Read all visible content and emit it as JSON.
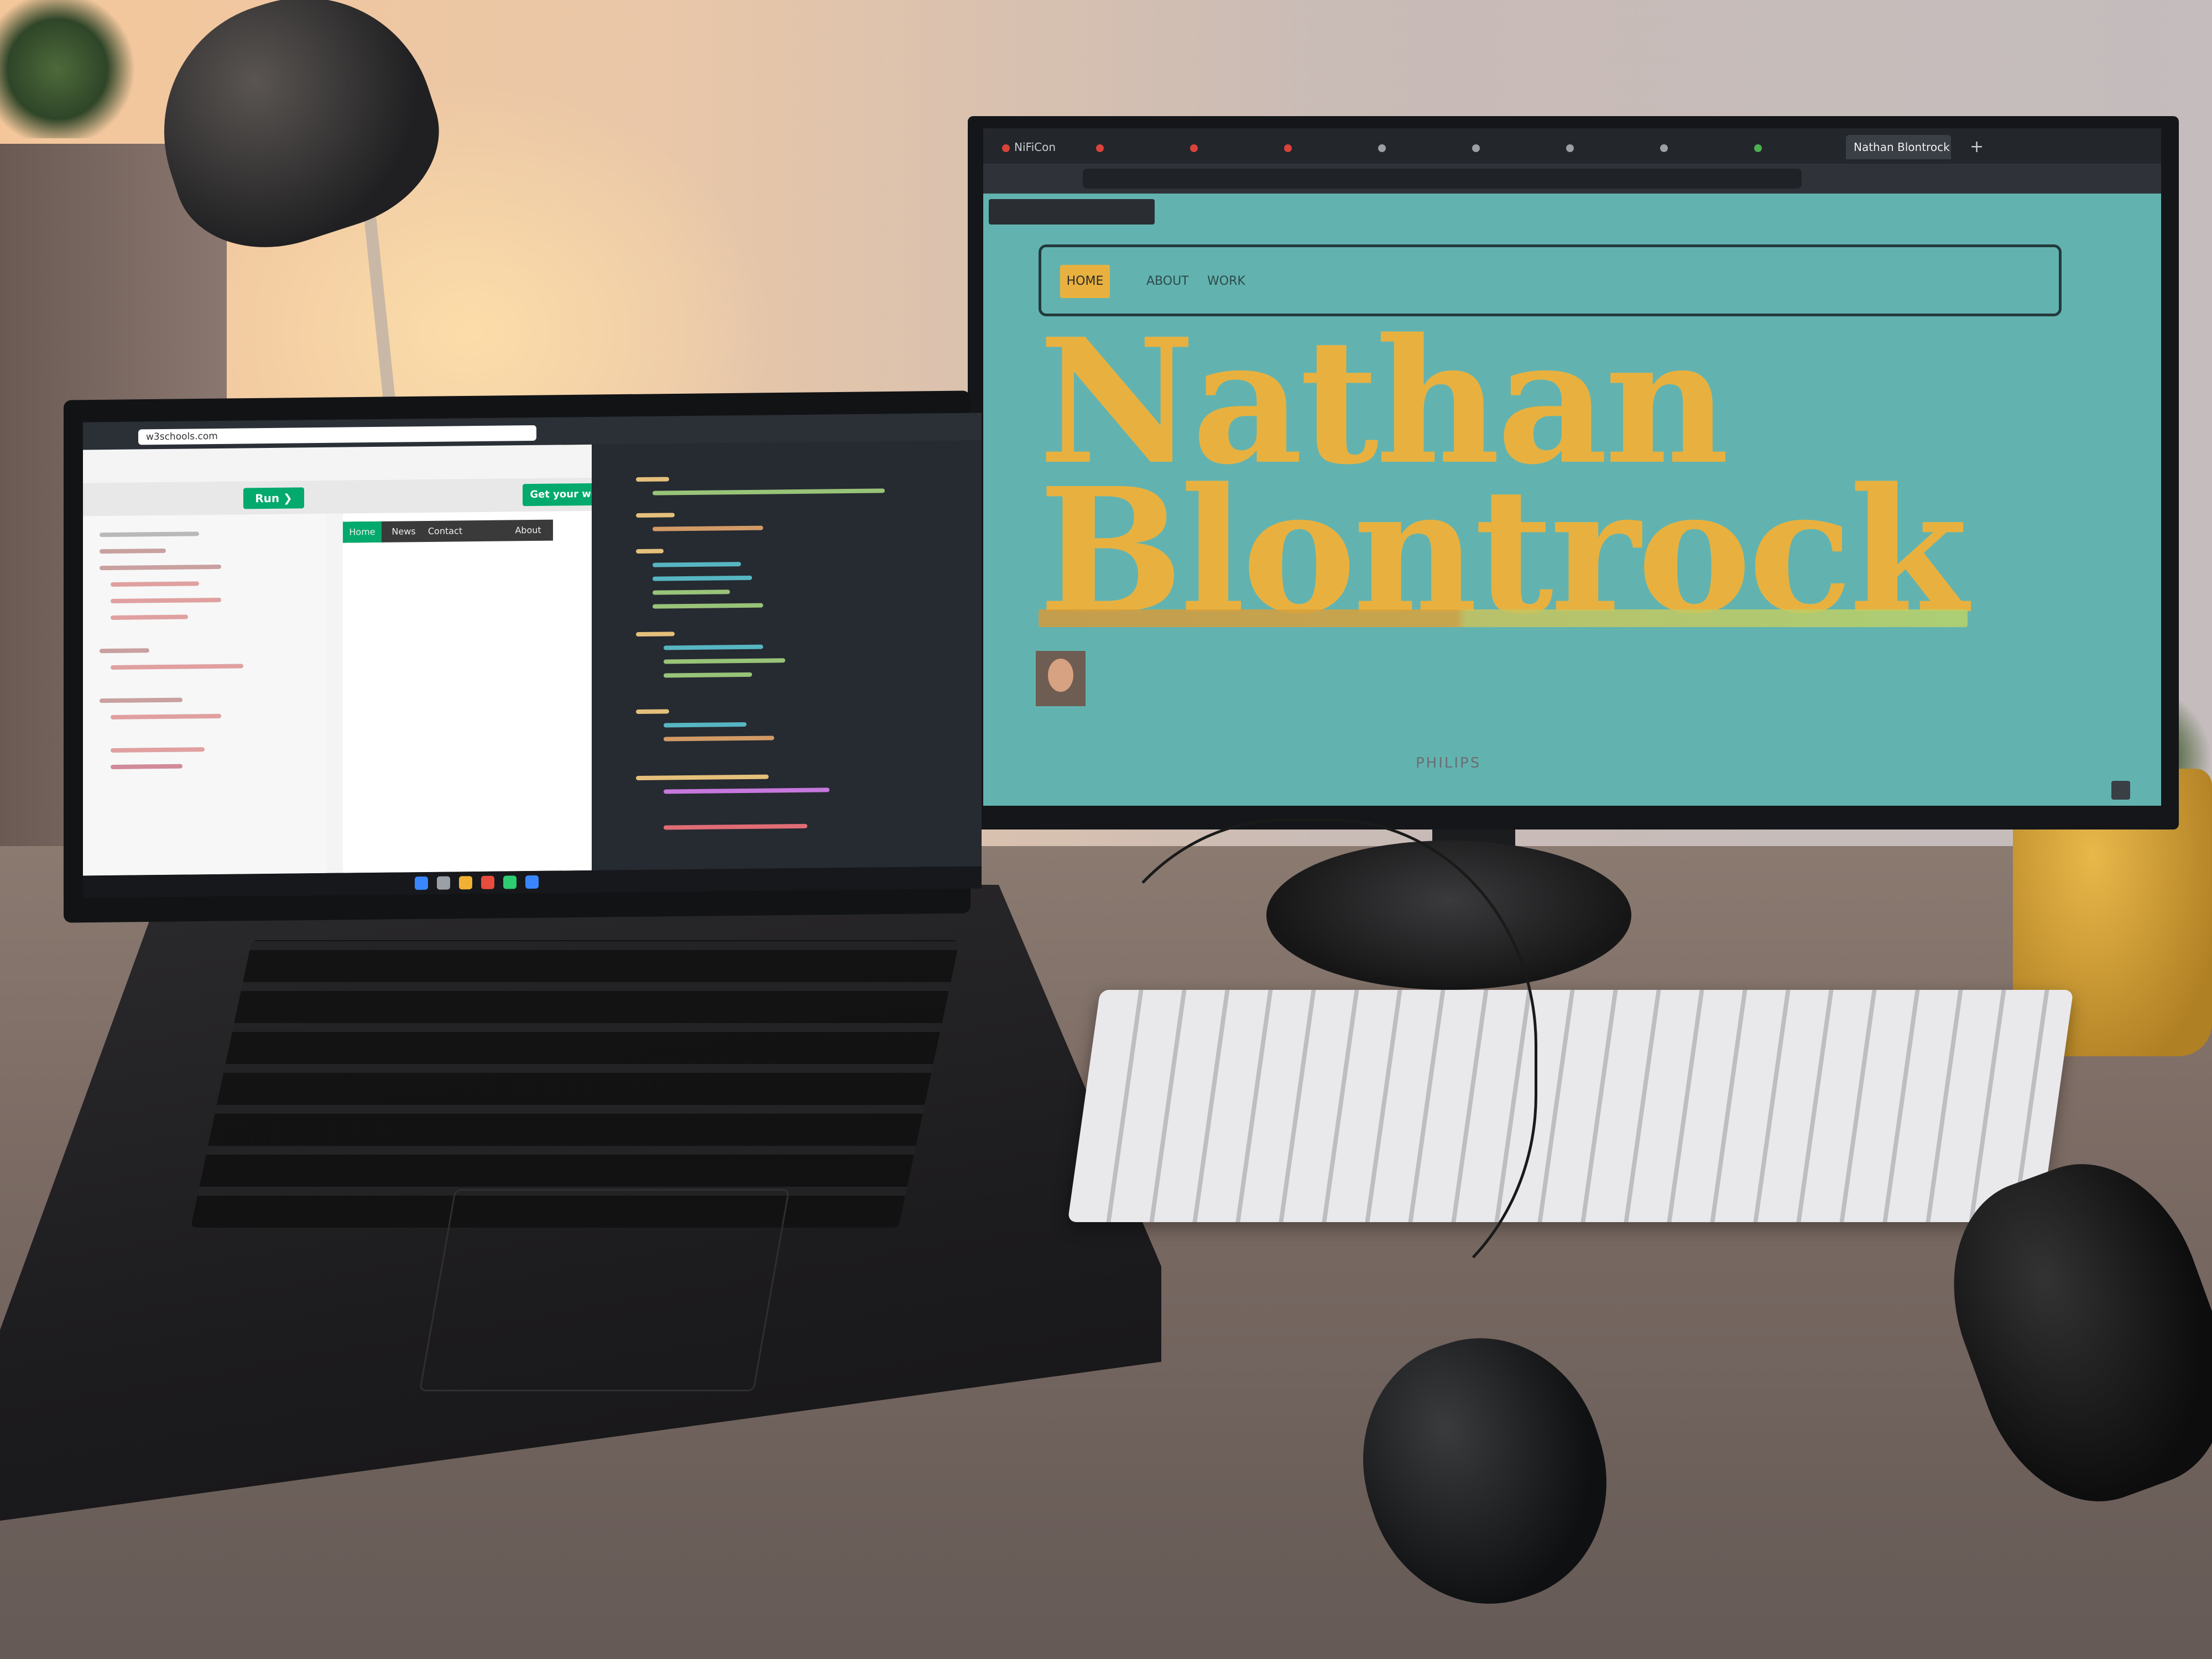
{
  "monitor": {
    "tabs": [
      "NiFiCon",
      "Nathan Blontrock"
    ],
    "active_tab": "Nathan Blontrock",
    "site": {
      "nav": [
        "HOME",
        "ABOUT",
        "WORK"
      ],
      "name_line1": "Nathan",
      "name_line2": "Blontrock"
    },
    "brand": "PHILIPS"
  },
  "laptop": {
    "url": "w3schools.com",
    "run_label": "Run ❯",
    "get_website_label": "Get your website",
    "result_nav": [
      "Home",
      "News",
      "Contact",
      "About"
    ]
  },
  "colors": {
    "site_bg": "#62b3b0",
    "site_accent": "#e8b13f",
    "w3_green": "#04aa6d"
  }
}
